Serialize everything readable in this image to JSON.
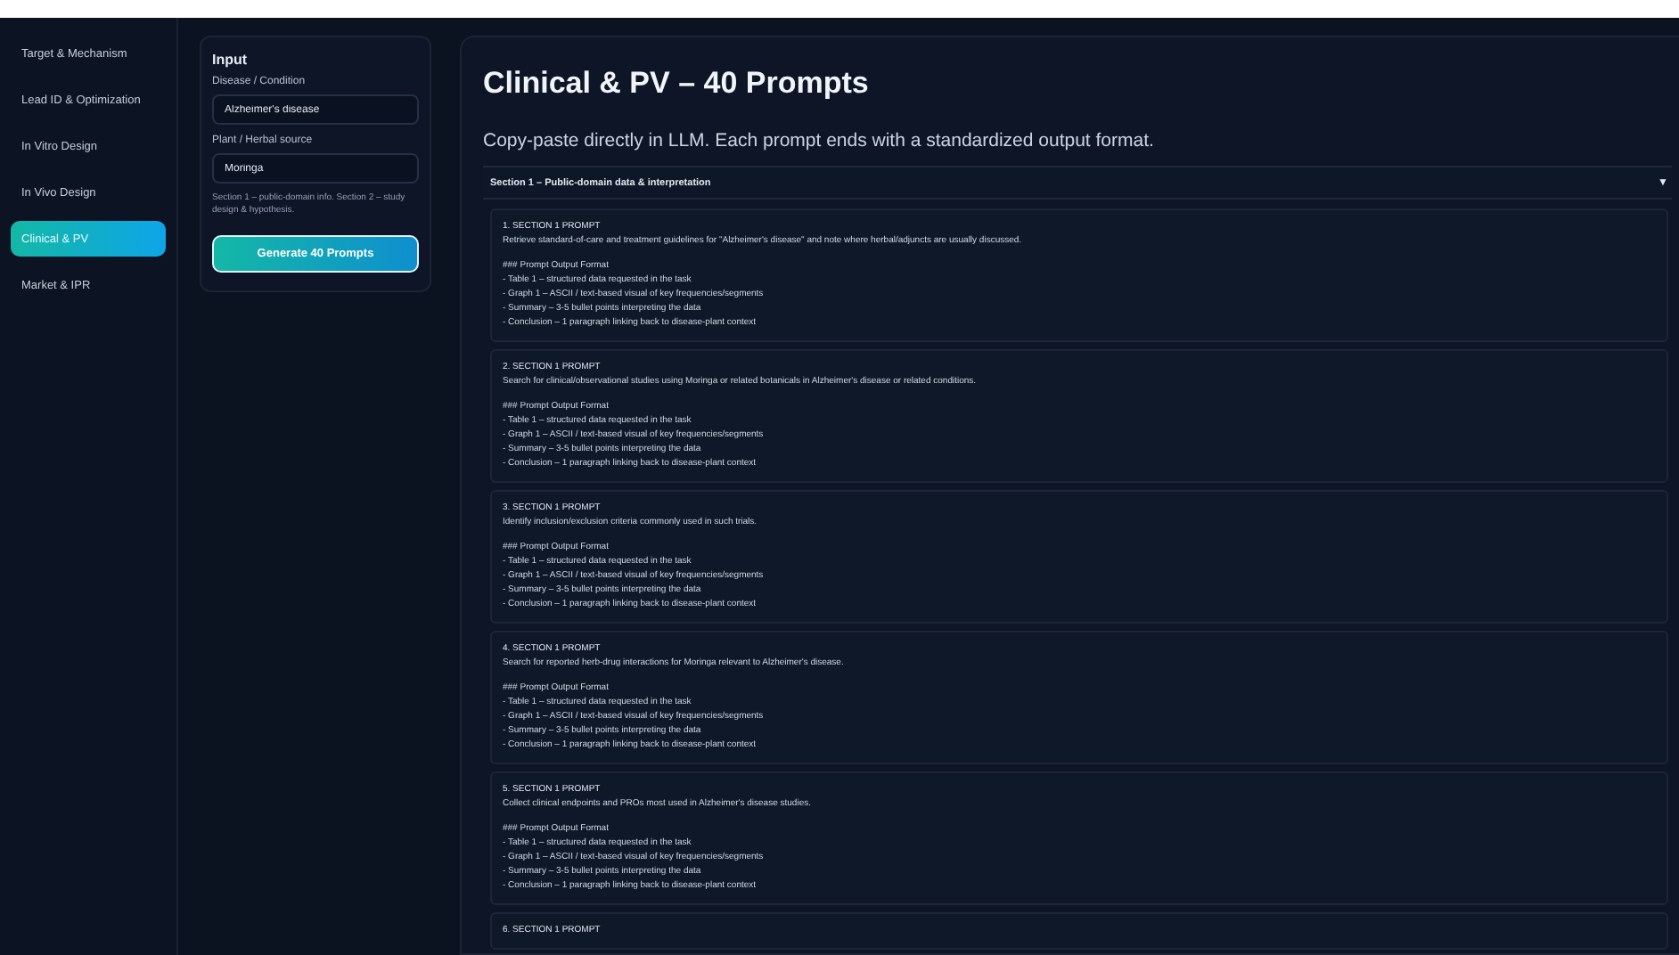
{
  "sidebar": {
    "items": [
      {
        "label": "Target & Mechanism",
        "selected": false
      },
      {
        "label": "Lead ID & Optimization",
        "selected": false
      },
      {
        "label": "In Vitro Design",
        "selected": false
      },
      {
        "label": "In Vivo Design",
        "selected": false
      },
      {
        "label": "Clinical & PV",
        "selected": true
      },
      {
        "label": "Market & IPR",
        "selected": false
      }
    ]
  },
  "input_panel": {
    "title": "Input",
    "fields": [
      {
        "label": "Disease / Condition",
        "value": "Alzheimer's disease"
      },
      {
        "label": "Plant / Herbal source",
        "value": "Moringa"
      }
    ],
    "hint": "Section 1 – public-domain info. Section 2 – study design & hypothesis.",
    "button": "Generate 40 Prompts"
  },
  "main": {
    "title": "Clinical & PV – 40 Prompts",
    "subtitle": "Copy-paste directly in LLM. Each prompt ends with a standardized output format.",
    "section": {
      "label": "Section 1 – Public-domain data & interpretation",
      "caret": "▼",
      "expanded": true
    },
    "prompts": [
      {
        "title": "1. SECTION 1 PROMPT",
        "text": "Retrieve standard-of-care and treatment guidelines for \"Alzheimer's disease\" and note where herbal/adjuncts are usually discussed.",
        "format_title": "### Prompt Output Format",
        "format_lines": [
          "- Table 1 – structured data requested in the task",
          "- Graph 1 – ASCII / text-based visual of key frequencies/segments",
          "- Summary – 3-5 bullet points interpreting the data",
          "- Conclusion – 1 paragraph linking back to disease-plant context"
        ]
      },
      {
        "title": "2. SECTION 1 PROMPT",
        "text": "Search for clinical/observational studies using Moringa or related botanicals in Alzheimer's disease or related conditions.",
        "format_title": "### Prompt Output Format",
        "format_lines": [
          "- Table 1 – structured data requested in the task",
          "- Graph 1 – ASCII / text-based visual of key frequencies/segments",
          "- Summary – 3-5 bullet points interpreting the data",
          "- Conclusion – 1 paragraph linking back to disease-plant context"
        ]
      },
      {
        "title": "3. SECTION 1 PROMPT",
        "text": "Identify inclusion/exclusion criteria commonly used in such trials.",
        "format_title": "### Prompt Output Format",
        "format_lines": [
          "- Table 1 – structured data requested in the task",
          "- Graph 1 – ASCII / text-based visual of key frequencies/segments",
          "- Summary – 3-5 bullet points interpreting the data",
          "- Conclusion – 1 paragraph linking back to disease-plant context"
        ]
      },
      {
        "title": "4. SECTION 1 PROMPT",
        "text": "Search for reported herb-drug interactions for Moringa relevant to Alzheimer's disease.",
        "format_title": "### Prompt Output Format",
        "format_lines": [
          "- Table 1 – structured data requested in the task",
          "- Graph 1 – ASCII / text-based visual of key frequencies/segments",
          "- Summary – 3-5 bullet points interpreting the data",
          "- Conclusion – 1 paragraph linking back to disease-plant context"
        ]
      },
      {
        "title": "5. SECTION 1 PROMPT",
        "text": "Collect clinical endpoints and PROs most used in Alzheimer's disease studies.",
        "format_title": "### Prompt Output Format",
        "format_lines": [
          "- Table 1 – structured data requested in the task",
          "- Graph 1 – ASCII / text-based visual of key frequencies/segments",
          "- Summary – 3-5 bullet points interpreting the data",
          "- Conclusion – 1 paragraph linking back to disease-plant context"
        ]
      },
      {
        "title": "6. SECTION 1 PROMPT"
      }
    ]
  }
}
